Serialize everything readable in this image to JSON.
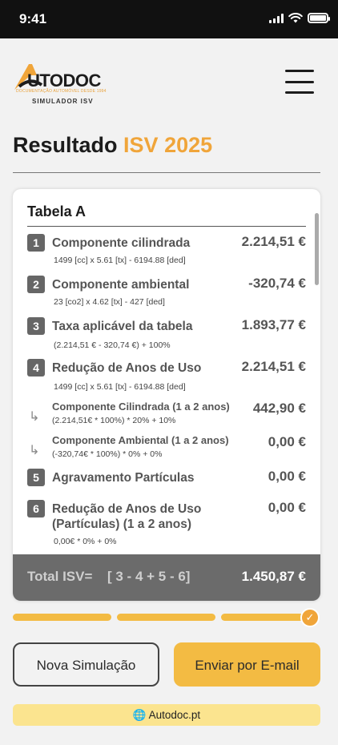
{
  "status": {
    "time": "9:41"
  },
  "header": {
    "brand": "UTODOC",
    "tagline": "DOCUMENTAÇÃO AUTOMÓVEL DESDE 1994",
    "subtitle": "SIMULADOR ISV"
  },
  "page": {
    "title_prefix": "Resultado",
    "title_accent": "ISV 2025"
  },
  "table": {
    "name": "Tabela A",
    "rows": [
      {
        "num": "1",
        "label": "Componente cilindrada",
        "amount": "2.214,51 €",
        "formula": "1499 [cc] x 5.61 [tx] - 6194.88 [ded]"
      },
      {
        "num": "2",
        "label": "Componente ambiental",
        "amount": "-320,74 €",
        "formula": "23 [co2] x 4.62 [tx] - 427 [ded]"
      },
      {
        "num": "3",
        "label": "Taxa aplicável da tabela",
        "amount": "1.893,77 €",
        "formula": "(2.214,51 € - 320,74 €)    +    100%"
      },
      {
        "num": "4",
        "label": "Redução de Anos de Uso",
        "amount": "2.214,51 €",
        "formula": "1499 [cc] x 5.61 [tx] - 6194.88 [ded]"
      },
      {
        "num": "5",
        "label": "Agravamento Partículas",
        "amount": "0,00 €"
      },
      {
        "num": "6",
        "label": "Redução de Anos de Uso (Partículas) (1 a 2 anos)",
        "amount": "0,00 €",
        "formula": "0,00€ * 0%    +    0%"
      }
    ],
    "subrows": [
      {
        "arrow": "↳",
        "label": "Componente Cilindrada (1 a 2 anos)",
        "detail": "(2.214,51€ * 100%) * 20% + 10%",
        "amount": "442,90 €"
      },
      {
        "arrow": "↳",
        "label": "Componente Ambiental (1 a 2 anos)",
        "detail": "(-320,74€ * 100%) * 0% + 0%",
        "amount": "0,00 €"
      }
    ],
    "total_label": "Total ISV=",
    "total_expr": "[ 3 - 4 + 5 - 6]",
    "total_value": "1.450,87 €"
  },
  "progress": {
    "steps_total": 3,
    "steps_done": 3
  },
  "buttons": {
    "new": "Nova Simulação",
    "email": "Enviar por E-mail"
  },
  "footer": {
    "link": "Autodoc.pt"
  },
  "colors": {
    "accent": "#f0a53a",
    "progress": "#f3bb43",
    "footer_bg": "#fbe48f",
    "total_bg": "#6b6b6b"
  }
}
